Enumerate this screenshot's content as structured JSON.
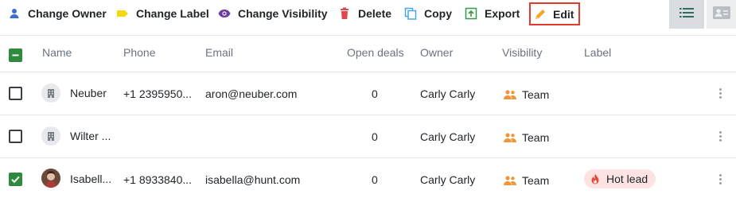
{
  "toolbar": {
    "change_owner": "Change Owner",
    "change_label": "Change Label",
    "change_visibility": "Change Visibility",
    "delete": "Delete",
    "copy": "Copy",
    "export": "Export",
    "edit": "Edit"
  },
  "colors": {
    "owner_icon": "#3b6fd1",
    "label_icon": "#f5d90a",
    "visibility_icon": "#6b3fa0",
    "delete_icon": "#e0474c",
    "copy_icon": "#4aa8e0",
    "export_icon": "#2e9c45",
    "edit_icon": "#f5a623",
    "highlight_border": "#e23b2b",
    "checkbox_on": "#2e8b3e",
    "team_icon": "#f0963a",
    "hot_lead_bg": "#fde4e2",
    "hot_lead_icon": "#e04a3a"
  },
  "table": {
    "headers": {
      "name": "Name",
      "phone": "Phone",
      "email": "Email",
      "open_deals": "Open deals",
      "owner": "Owner",
      "visibility": "Visibility",
      "label": "Label"
    },
    "rows": [
      {
        "selected": false,
        "avatar": "building-icon",
        "name": "Neuber",
        "phone": "+1 2395950...",
        "email": "aron@neuber.com",
        "open_deals": "0",
        "owner": "Carly Carly",
        "visibility": "Team",
        "label": ""
      },
      {
        "selected": false,
        "avatar": "building-icon",
        "name": "Wilter ...",
        "phone": "",
        "email": "",
        "open_deals": "0",
        "owner": "Carly Carly",
        "visibility": "Team",
        "label": ""
      },
      {
        "selected": true,
        "avatar": "person-photo",
        "name": "Isabell...",
        "phone": "+1 8933840...",
        "email": "isabella@hunt.com",
        "open_deals": "0",
        "owner": "Carly Carly",
        "visibility": "Team",
        "label": "Hot lead"
      }
    ]
  }
}
